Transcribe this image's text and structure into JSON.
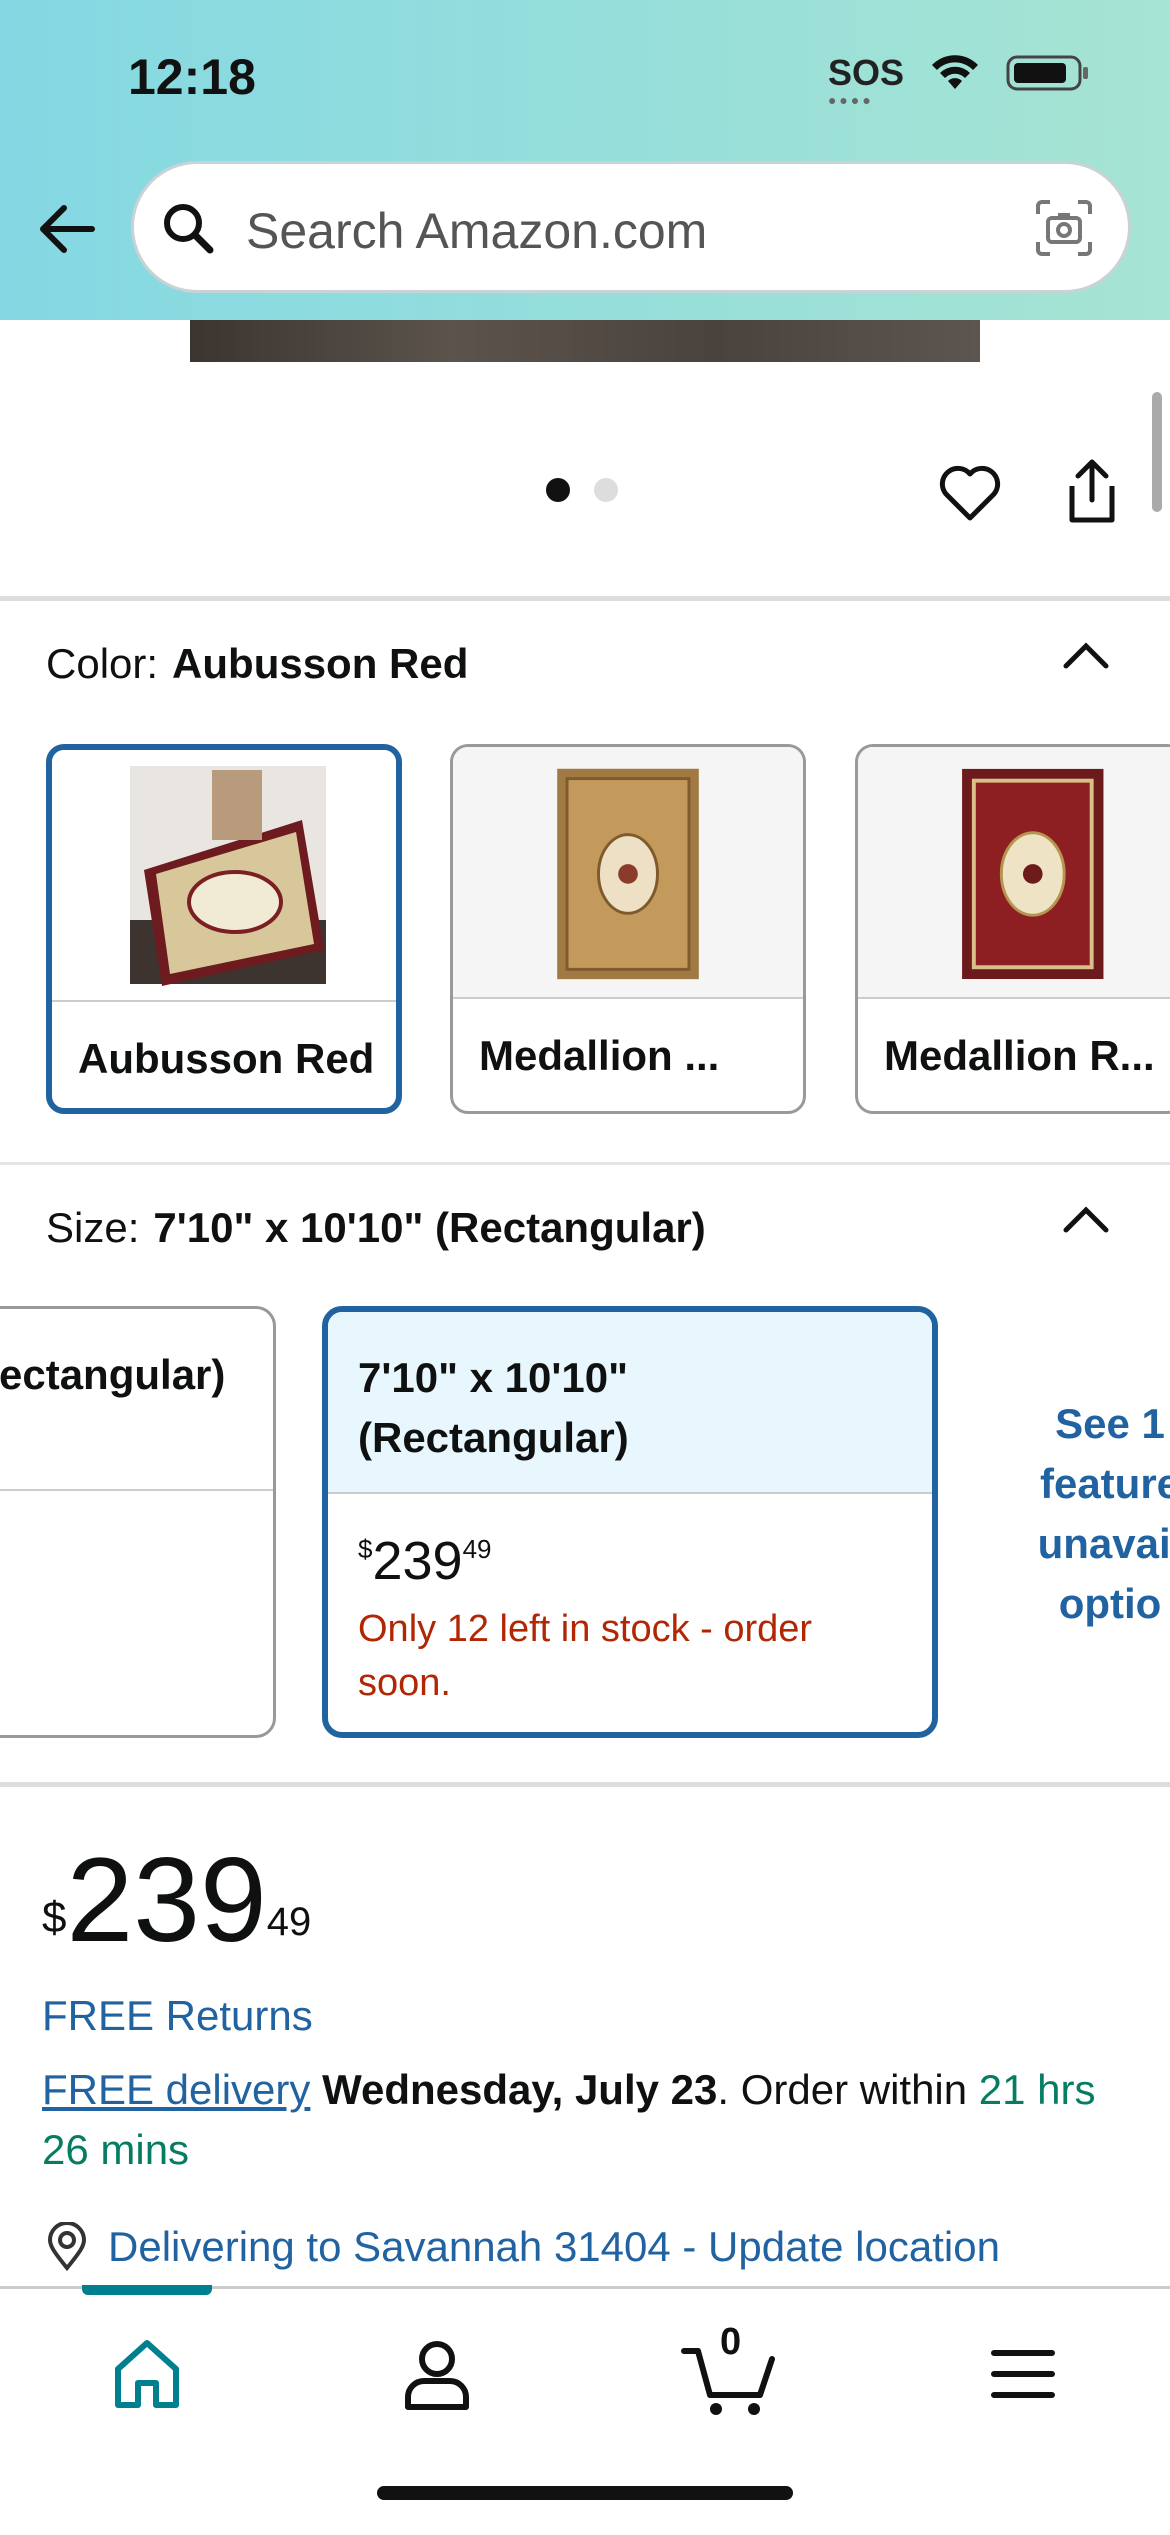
{
  "status_bar": {
    "time": "12:18",
    "sos": "SOS"
  },
  "search": {
    "placeholder": "Search Amazon.com"
  },
  "image_carousel": {
    "total_dots": 2,
    "active_index": 0
  },
  "color": {
    "label": "Color:",
    "selected": "Aubusson Red",
    "options": [
      {
        "label": "Aubusson Red",
        "selected": true
      },
      {
        "label": "Medallion ...",
        "selected": false
      },
      {
        "label": "Medallion R...",
        "selected": false
      }
    ]
  },
  "size": {
    "label": "Size:",
    "selected": "7'10\" x 10'10\" (Rectangular)",
    "options": [
      {
        "title": "ectangular)",
        "selected": false
      },
      {
        "title_line1": "7'10\" x 10'10\"",
        "title_line2": "(Rectangular)",
        "price_symbol": "$",
        "price_whole": "239",
        "price_cents": "49",
        "stock": "Only 12 left in stock - order soon.",
        "selected": true
      }
    ],
    "see_more_lines": [
      "See 1",
      "feature",
      "unavail",
      "optio"
    ]
  },
  "price": {
    "symbol": "$",
    "whole": "239",
    "cents": "49"
  },
  "free_returns": "FREE Returns",
  "delivery": {
    "link": "FREE delivery",
    "date": "Wednesday, July 23",
    "order_within": ". Order within ",
    "countdown": "21 hrs 26 mins"
  },
  "deliver_to": "Delivering to Savannah 31404 - Update location",
  "bottom_nav": {
    "cart_count": "0"
  },
  "colors": {
    "accent_blue": "#2162a1",
    "stock_red": "#b12704",
    "green": "#067d62",
    "teal": "#00808f"
  }
}
